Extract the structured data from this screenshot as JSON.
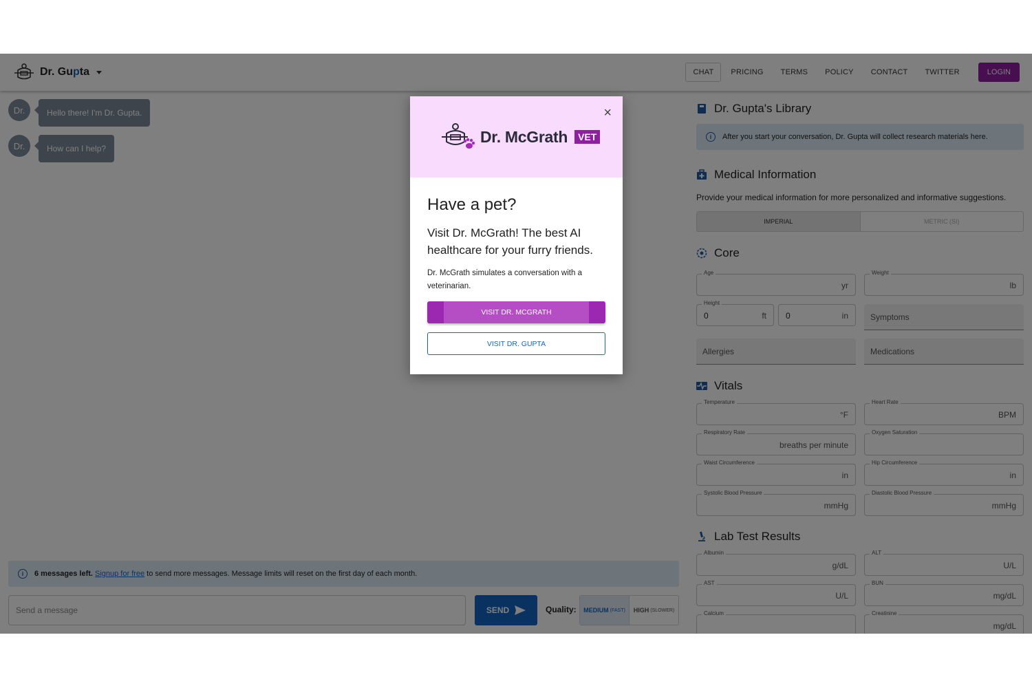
{
  "navbar": {
    "brand_prefix": "Dr. ",
    "brand_name_a": "Gu",
    "brand_name_b": "p",
    "brand_name_c": "ta",
    "links": [
      "CHAT",
      "PRICING",
      "TERMS",
      "POLICY",
      "CONTACT",
      "TWITTER"
    ],
    "login": "LOGIN"
  },
  "chat": {
    "avatar": "Dr.",
    "messages": [
      "Hello there! I'm Dr. Gupta.",
      "How can I help?"
    ],
    "limit_bold": "6 messages left.",
    "limit_link": "Signup for free",
    "limit_rest": "to send more messages. Message limits will reset on the first day of each month.",
    "placeholder": "Send a message",
    "send": "SEND",
    "quality_label": "Quality:",
    "quality_options": [
      {
        "name": "MEDIUM",
        "hint": "(FAST)"
      },
      {
        "name": "HIGH",
        "hint": "(SLOWER)"
      }
    ]
  },
  "library": {
    "title": "Dr. Gupta's Library",
    "info": "After you start your conversation, Dr. Gupta will collect research materials here."
  },
  "medical": {
    "title": "Medical Information",
    "description": "Provide your medical information for more personalized and informative suggestions.",
    "units": [
      "IMPERIAL",
      "METRIC (SI)"
    ]
  },
  "core": {
    "title": "Core",
    "age_label": "Age",
    "age_unit": "yr",
    "weight_label": "Weight",
    "weight_unit": "lb",
    "height_label": "Height",
    "height_ft": "0",
    "ft_unit": "ft",
    "height_in": "0",
    "in_unit": "in",
    "symptoms": "Symptoms",
    "allergies": "Allergies",
    "medications": "Medications"
  },
  "vitals": {
    "title": "Vitals",
    "fields": [
      {
        "label": "Temperature",
        "unit": "°F"
      },
      {
        "label": "Heart Rate",
        "unit": "BPM"
      },
      {
        "label": "Respiratory Rate",
        "unit": "breaths per minute"
      },
      {
        "label": "Oxygen Saturation",
        "unit": ""
      },
      {
        "label": "Waist Circumference",
        "unit": "in"
      },
      {
        "label": "Hip Circumference",
        "unit": "in"
      },
      {
        "label": "Systolic Blood Pressure",
        "unit": "mmHg"
      },
      {
        "label": "Diastolic Blood Pressure",
        "unit": "mmHg"
      }
    ]
  },
  "labs": {
    "title": "Lab Test Results",
    "fields": [
      {
        "label": "Albumin",
        "unit": "g/dL"
      },
      {
        "label": "ALT",
        "unit": "U/L"
      },
      {
        "label": "AST",
        "unit": "U/L"
      },
      {
        "label": "BUN",
        "unit": "mg/dL"
      },
      {
        "label": "Calcium",
        "unit": ""
      },
      {
        "label": "Creatinine",
        "unit": "mg/dL"
      }
    ]
  },
  "modal": {
    "logo_text": "Dr. McGrath",
    "badge": "VET",
    "close": "×",
    "heading": "Have a pet?",
    "lead": "Visit Dr. McGrath! The best AI healthcare for your furry friends.",
    "small": "Dr. McGrath simulates a conversation with a veterinarian.",
    "primary": "VISIT DR. MCGRATH",
    "secondary": "VISIT DR. GUPTA"
  },
  "colors": {
    "brand_purple": "#8e1f9e",
    "accent_blue": "#1565c0",
    "modal_header": "#f9dcfd"
  },
  "icons": [
    "doctor-logo-icon",
    "caret-down-icon",
    "info-icon",
    "send-icon",
    "book-icon",
    "medical-bag-icon",
    "target-icon",
    "vitals-icon",
    "microscope-icon",
    "close-icon",
    "vet-logo-icon"
  ]
}
